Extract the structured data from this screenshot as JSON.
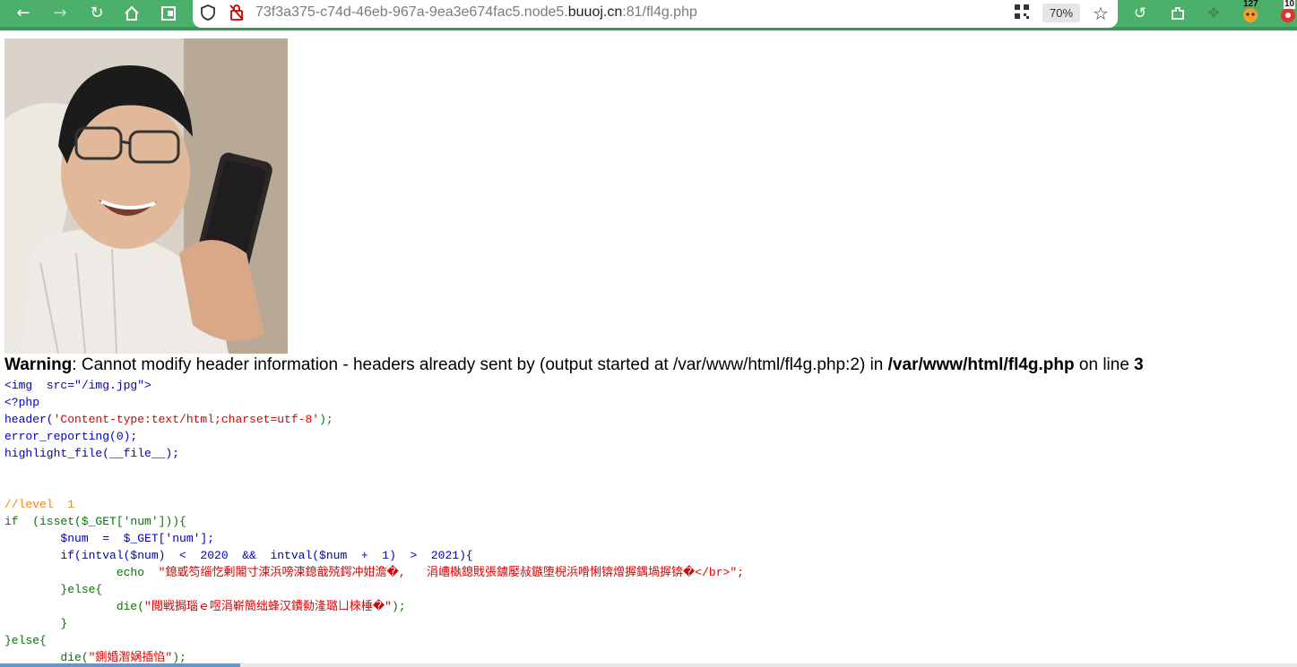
{
  "browser": {
    "url_host_prefix": "73f3a375-c74d-46eb-967a-9ea3e674fac5.node5.",
    "url_host_domain": "buuoj.cn",
    "url_path": ":81/fl4g.php",
    "zoom": "70%",
    "ext_badge_1": "127",
    "ext_badge_2": "10",
    "icons": [
      "back-icon",
      "forward-icon",
      "reload-icon",
      "home-icon",
      "tab-icon",
      "shield-icon",
      "insecure-icon",
      "qr-icon",
      "star-icon",
      "history-icon",
      "extensions-icon",
      "gear-icon",
      "tiger-icon",
      "app-icon"
    ]
  },
  "warning": {
    "label": "Warning",
    "message": ": Cannot modify header information - headers already sent by (output started at /var/www/html/fl4g.php:2) in ",
    "file": "/var/www/html/fl4g.php",
    "on_line": " on line ",
    "line": "3"
  },
  "code": {
    "l1": "<img  src=\"/img.jpg\">",
    "l2": "<?php",
    "l3": "header('Content-type:text/html;charset=utf-8');",
    "l4": "error_reporting(0);",
    "l5": "highlight_file(__file__);",
    "l8": "//level  1",
    "l9a": "if  (isset($_GET['num'])){",
    "l10a": "        $num  =  $_GET['num'];",
    "l11a": "        if(intval($num)  <  2020  &&  intval($num  +  1)  >  2021){",
    "l12a": "                echo  ",
    "l12b": "\"鎴戜笉缁忔剰闂寸湅浜嗙湅鎴戠殑鍔冲姏澹�,   涓嶆槸鎴戝張鐪嬮敊鏃堕棿浜嗗悧锛熷搱鍝堝搱锛�</br>\";",
    "l13a": "        }else{",
    "l14a": "                die(",
    "l14b": "\"閲戦挶瑙ｅ喅涓嶄簡绌蜂汉鐨勬湰璐ㄩ棶棰�\"",
    "l14c": ");",
    "l15a": "        }",
    "l16a": "}else{",
    "l17a": "        die(",
    "l17b": "\"鍘婚潪娲插惂\"",
    "l17c": ");"
  }
}
